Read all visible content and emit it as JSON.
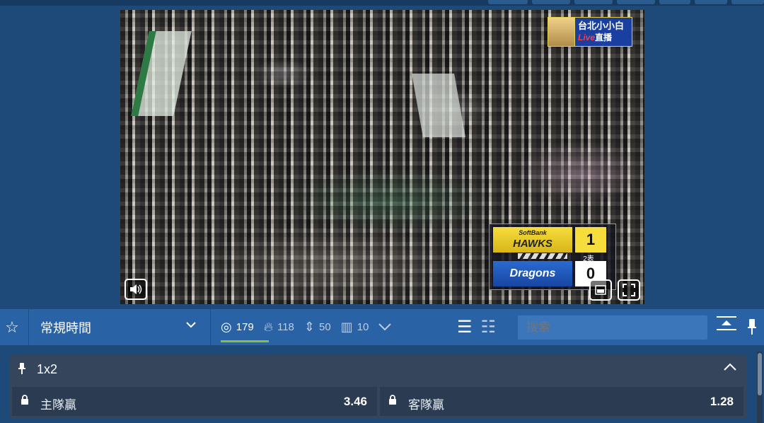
{
  "video": {
    "channel_logo": {
      "line1": "台北小小白",
      "live": "Live",
      "line2_suffix": "直播"
    },
    "scoreboard": {
      "home_team": "HAWKS",
      "home_team_prefix": "SoftBank",
      "home_score": "1",
      "away_team": "Dragons",
      "away_score": "0",
      "inning": "2表"
    },
    "volume_icon": "speaker-icon",
    "pip_icon": "picture-in-picture-icon",
    "fullscreen_icon": "fullscreen-icon"
  },
  "toolbar": {
    "favorite_icon": "star-icon",
    "period_label": "常規時間",
    "stats": [
      {
        "icon": "target-icon",
        "value": "179"
      },
      {
        "icon": "fire-icon",
        "value": "118"
      },
      {
        "icon": "sort-icon",
        "value": "50"
      },
      {
        "icon": "bars-icon",
        "value": "10"
      }
    ],
    "search_placeholder": "搜索"
  },
  "market": {
    "name": "1x2",
    "outcomes": [
      {
        "label": "主隊贏",
        "odds": "3.46"
      },
      {
        "label": "客隊贏",
        "odds": "1.28"
      }
    ]
  },
  "colors": {
    "background": "#1d4a78",
    "toolbar": "#2a62a6",
    "panel": "#34455c",
    "accent_underline": "#8fbf3a"
  }
}
